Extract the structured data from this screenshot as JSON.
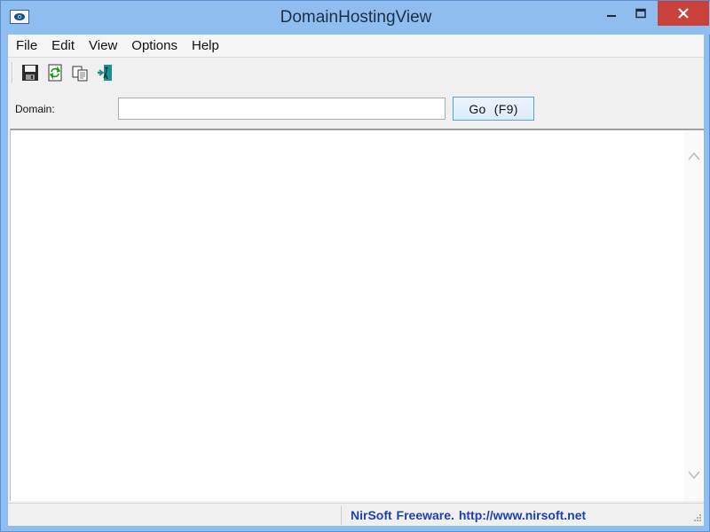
{
  "window": {
    "title": "DomainHostingView",
    "controls": {
      "minimize": "minimize-icon",
      "maximize": "maximize-icon",
      "close": "close-icon"
    }
  },
  "menu": {
    "items": [
      {
        "label": "File"
      },
      {
        "label": "Edit"
      },
      {
        "label": "View"
      },
      {
        "label": "Options"
      },
      {
        "label": "Help"
      }
    ]
  },
  "toolbar": {
    "buttons": [
      {
        "icon": "save-icon"
      },
      {
        "icon": "refresh-icon"
      },
      {
        "icon": "copy-icon"
      },
      {
        "icon": "exit-icon"
      }
    ]
  },
  "domain": {
    "label": "Domain:",
    "value": "",
    "placeholder": "",
    "go_label": "Go (F9)"
  },
  "status": {
    "pane1": "",
    "link_text": "NirSoft Freeware.  http://www.nirsoft.net"
  },
  "colors": {
    "title_bar": "#8fbdf0",
    "close_button": "#c9413a",
    "status_link": "#1f3fb5"
  }
}
